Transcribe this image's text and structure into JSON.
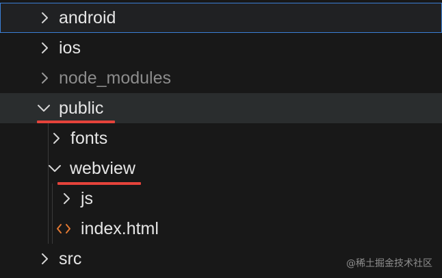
{
  "explorer": {
    "items": [
      {
        "label": "android"
      },
      {
        "label": "ios"
      },
      {
        "label": "node_modules"
      },
      {
        "label": "public"
      },
      {
        "label": "fonts"
      },
      {
        "label": "webview"
      },
      {
        "label": "js"
      },
      {
        "label": "index.html"
      },
      {
        "label": "src"
      }
    ]
  },
  "watermark": "@稀土掘金技术社区",
  "colors": {
    "background": "#181818",
    "selected_border": "#3b80d8",
    "hover_bg": "#2a2d2e",
    "annotation_underline": "#e5433b",
    "html_icon": "#e37933"
  }
}
